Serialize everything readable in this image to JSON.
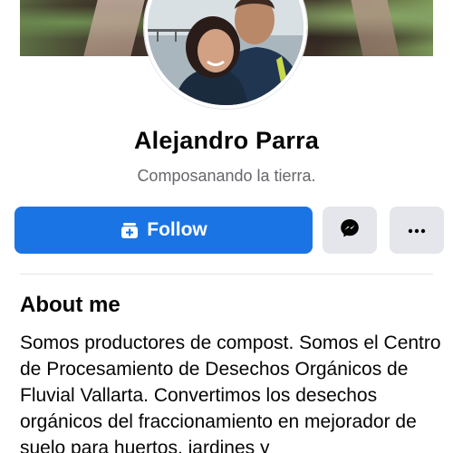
{
  "profile": {
    "name": "Alejandro Parra",
    "bio": "Composanando la tierra."
  },
  "actions": {
    "follow_label": "Follow",
    "follow_icon": "add-friend-icon",
    "messenger_icon": "messenger-icon",
    "more_icon": "more-dots-icon"
  },
  "about": {
    "title": "About me",
    "text": "Somos productores de compost. Somos el Centro de Procesamiento de Desechos Orgánicos de Fluvial Vallarta. Convertimos los desechos orgánicos del fraccionamiento en mejorador de suelo para huertos, jardines y"
  },
  "colors": {
    "primary": "#1b74e4",
    "secondary_button": "#e4e6eb",
    "text_primary": "#050505",
    "text_secondary": "#65676b"
  }
}
